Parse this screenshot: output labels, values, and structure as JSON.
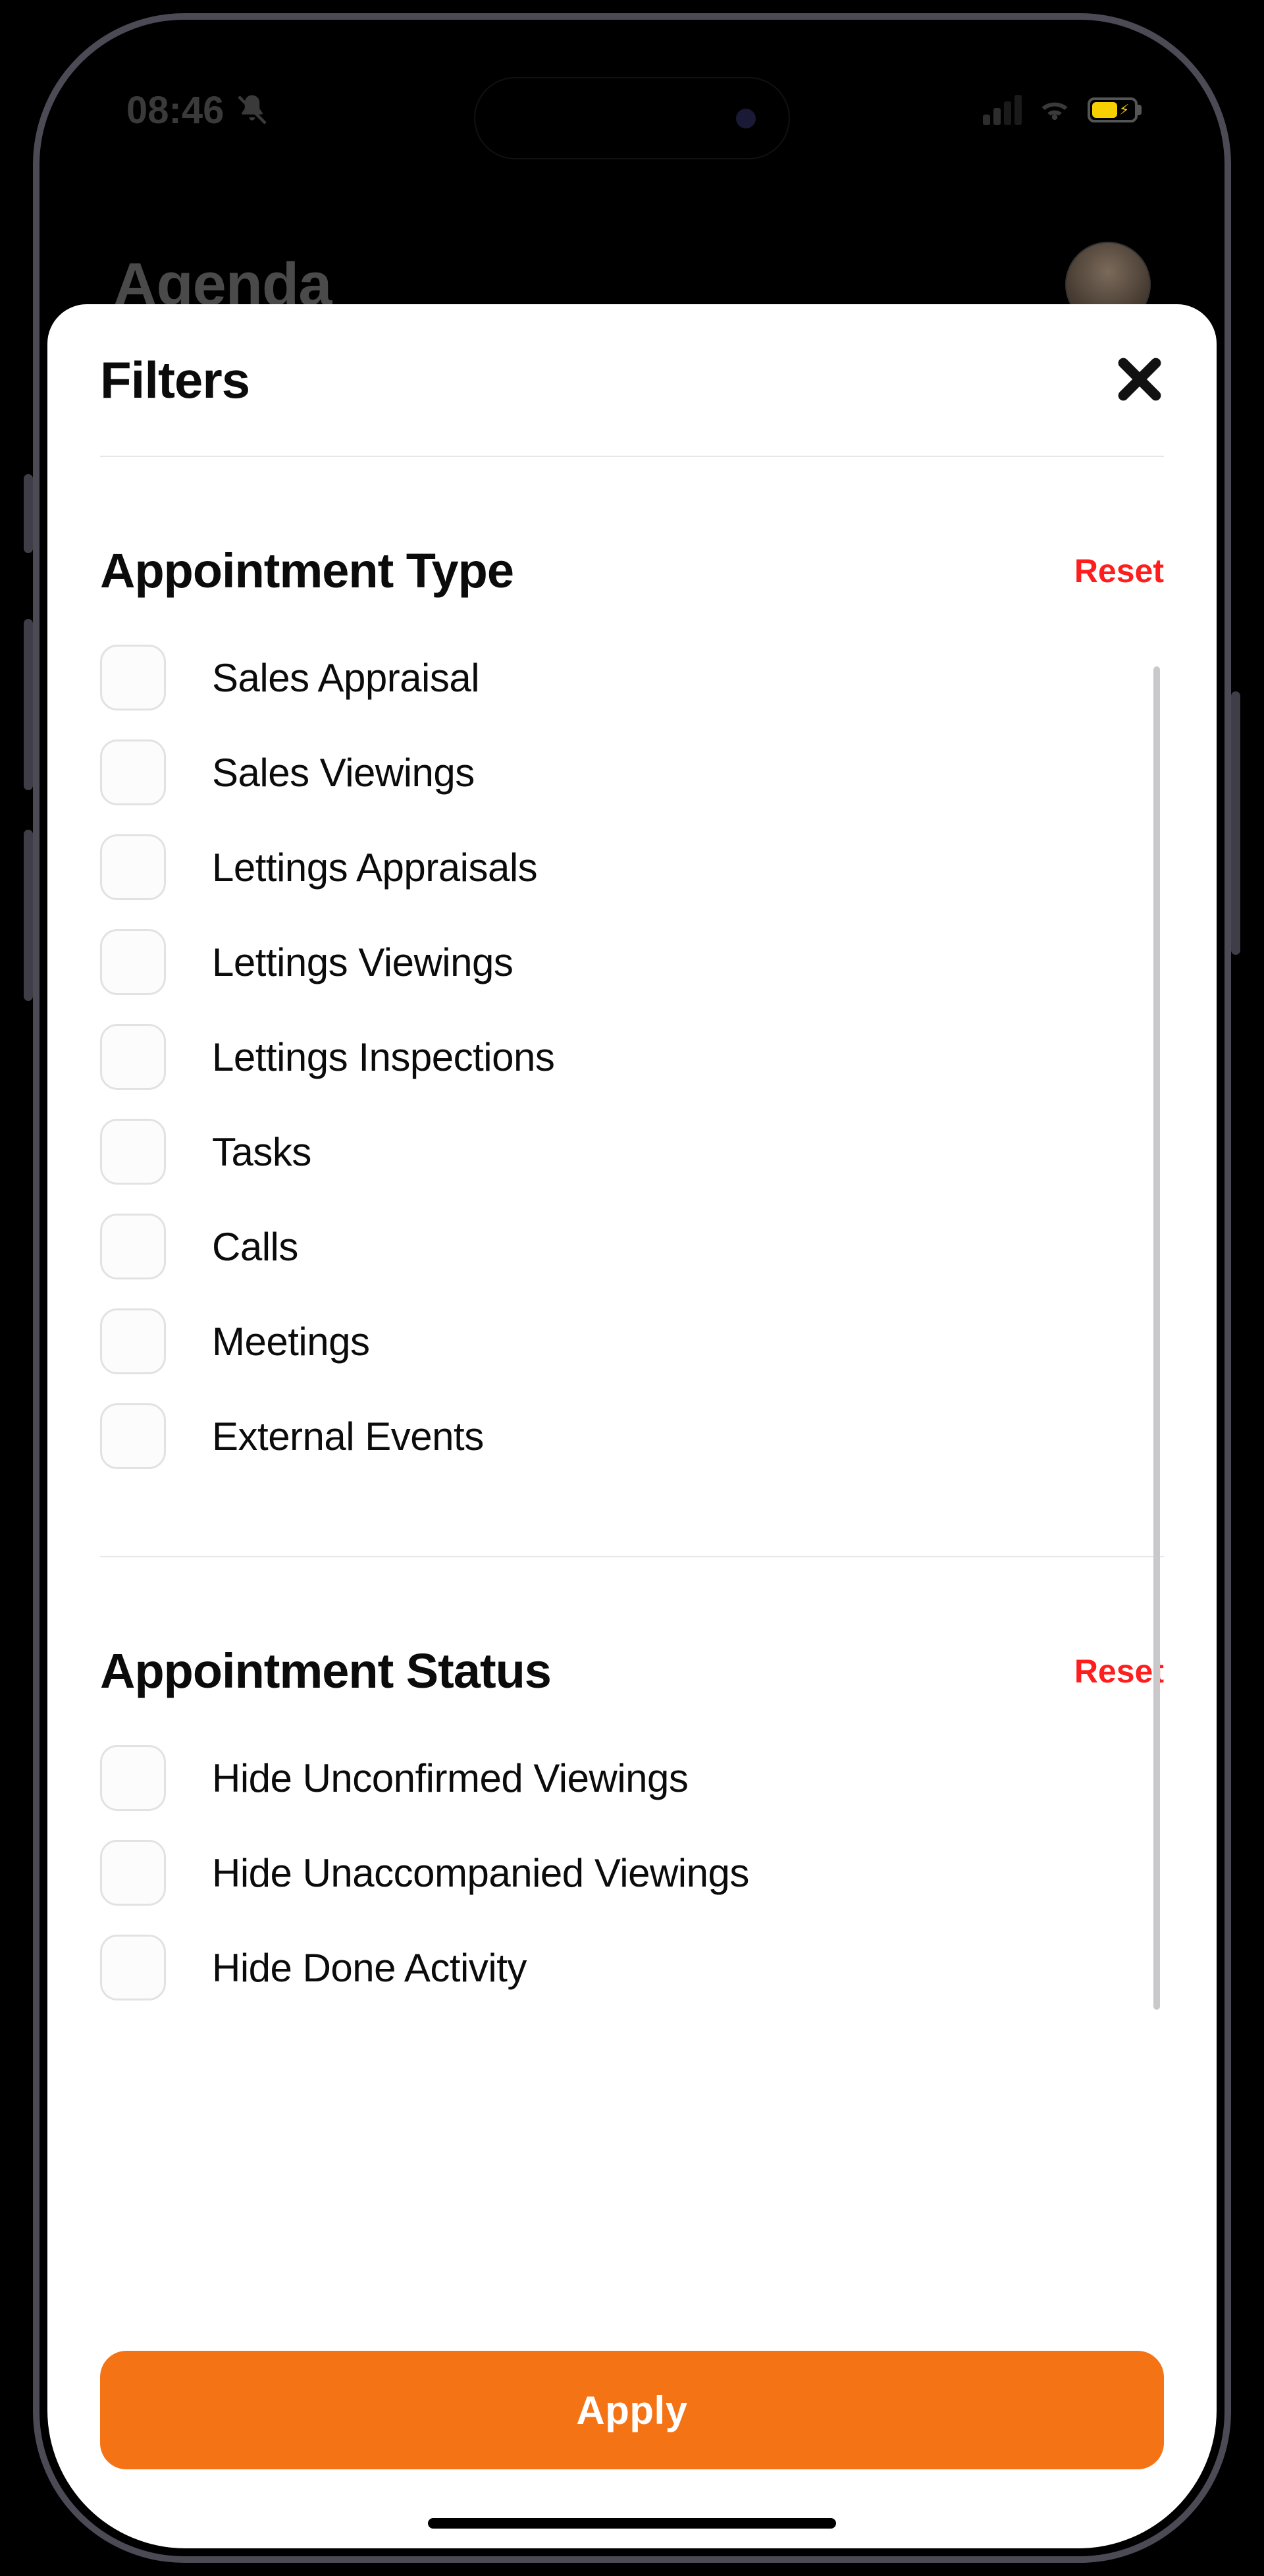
{
  "status": {
    "time": "08:46"
  },
  "agenda": {
    "title": "Agenda"
  },
  "sheet": {
    "title": "Filters",
    "apply_label": "Apply",
    "sections": [
      {
        "title": "Appointment Type",
        "reset_label": "Reset",
        "options": [
          "Sales Appraisal",
          "Sales Viewings",
          "Lettings Appraisals",
          "Lettings Viewings",
          "Lettings Inspections",
          "Tasks",
          "Calls",
          "Meetings",
          "External Events"
        ]
      },
      {
        "title": "Appointment Status",
        "reset_label": "Reset",
        "options": [
          "Hide Unconfirmed Viewings",
          "Hide Unaccompanied Viewings",
          "Hide Done Activity"
        ]
      }
    ]
  },
  "colors": {
    "accent": "#f47315",
    "danger": "#ff1e1e"
  }
}
